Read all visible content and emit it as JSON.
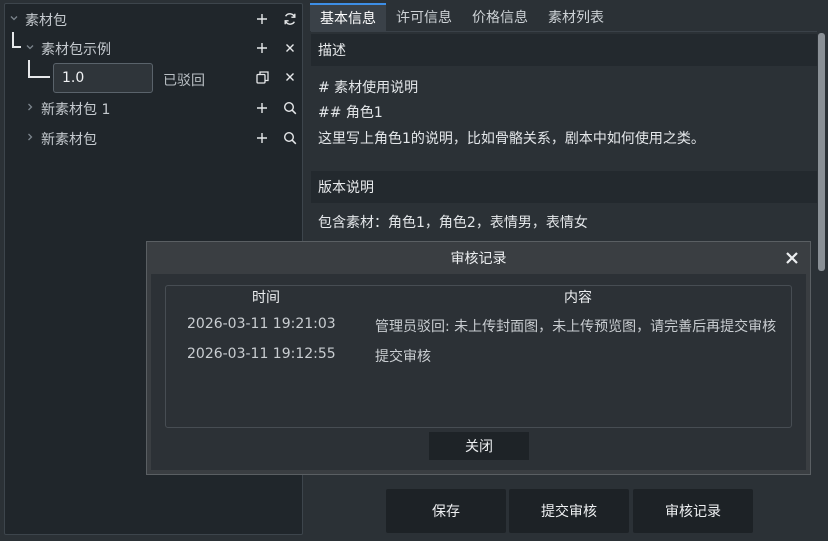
{
  "tree": {
    "root": {
      "label": "素材包",
      "add_icon": "plus-icon",
      "refresh_icon": "refresh-icon"
    },
    "example": {
      "label": "素材包示例",
      "add_icon": "plus-icon",
      "close_icon": "close-icon"
    },
    "version": {
      "value": "1.0",
      "status": "已驳回",
      "copy_icon": "copy-icon",
      "close_icon": "close-icon"
    },
    "items": [
      {
        "label": "新素材包 1",
        "add_icon": "plus-icon",
        "search_icon": "search-icon"
      },
      {
        "label": "新素材包",
        "add_icon": "plus-icon",
        "search_icon": "search-icon"
      }
    ]
  },
  "tabs": [
    "基本信息",
    "许可信息",
    "价格信息",
    "素材列表"
  ],
  "description": {
    "heading": "描述",
    "lines": [
      "# 素材使用说明",
      "## 角色1",
      "这里写上角色1的说明，比如骨骼关系，剧本中如何使用之类。"
    ]
  },
  "version_notes": {
    "heading": "版本说明",
    "text": "包含素材：角色1，角色2，表情男，表情女"
  },
  "buttons": {
    "save": "保存",
    "submit": "提交审核",
    "records": "审核记录"
  },
  "dialog": {
    "title": "审核记录",
    "columns": {
      "time": "时间",
      "content": "内容"
    },
    "rows": [
      {
        "time": "2026-03-11 19:21:03",
        "content": "管理员驳回: 未上传封面图，未上传预览图，请完善后再提交审核"
      },
      {
        "time": "2026-03-11 19:12:55",
        "content": "提交审核"
      }
    ],
    "close_label": "关闭"
  },
  "colors": {
    "accent": "#3d8ee6",
    "background": "#2b3136",
    "panel": "#20262b"
  }
}
